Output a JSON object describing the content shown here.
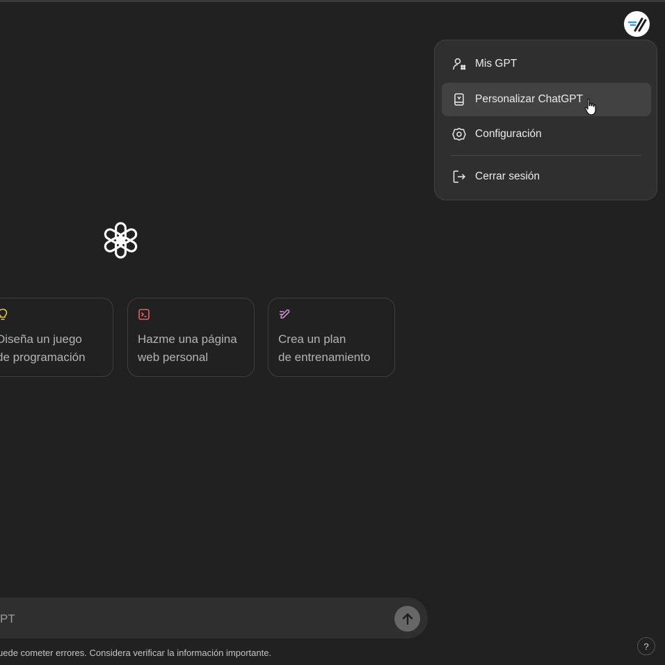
{
  "menu": {
    "items": [
      {
        "label": "Mis GPT",
        "icon": "gpts-icon"
      },
      {
        "label": "Personalizar ChatGPT",
        "icon": "customize-icon"
      },
      {
        "label": "Configuración",
        "icon": "gear-icon"
      },
      {
        "label": "Cerrar sesión",
        "icon": "logout-icon"
      }
    ]
  },
  "avatar": {
    "icon": "user-avatar-logo"
  },
  "logo": {
    "icon": "openai-logo"
  },
  "cards": [
    {
      "line1": "Diseña un juego",
      "line2": "de programación",
      "icon": "lightbulb-icon",
      "icon_color": "#e2c541"
    },
    {
      "line1": "Hazme una página",
      "line2": "web personal",
      "icon": "terminal-icon",
      "icon_color": "#e86161"
    },
    {
      "line1": "Crea un plan",
      "line2": "de entrenamiento",
      "icon": "pencil-icon",
      "icon_color": "#cb8bd0"
    }
  ],
  "composer": {
    "placeholder": "PT"
  },
  "disclaimer": "uede cometer errores. Considera verificar la información importante.",
  "help": {
    "label": "?"
  },
  "colors": {
    "background": "#212121",
    "menu_bg": "#2f2f2f",
    "hover_bg": "#424242",
    "text": "#ececec"
  }
}
